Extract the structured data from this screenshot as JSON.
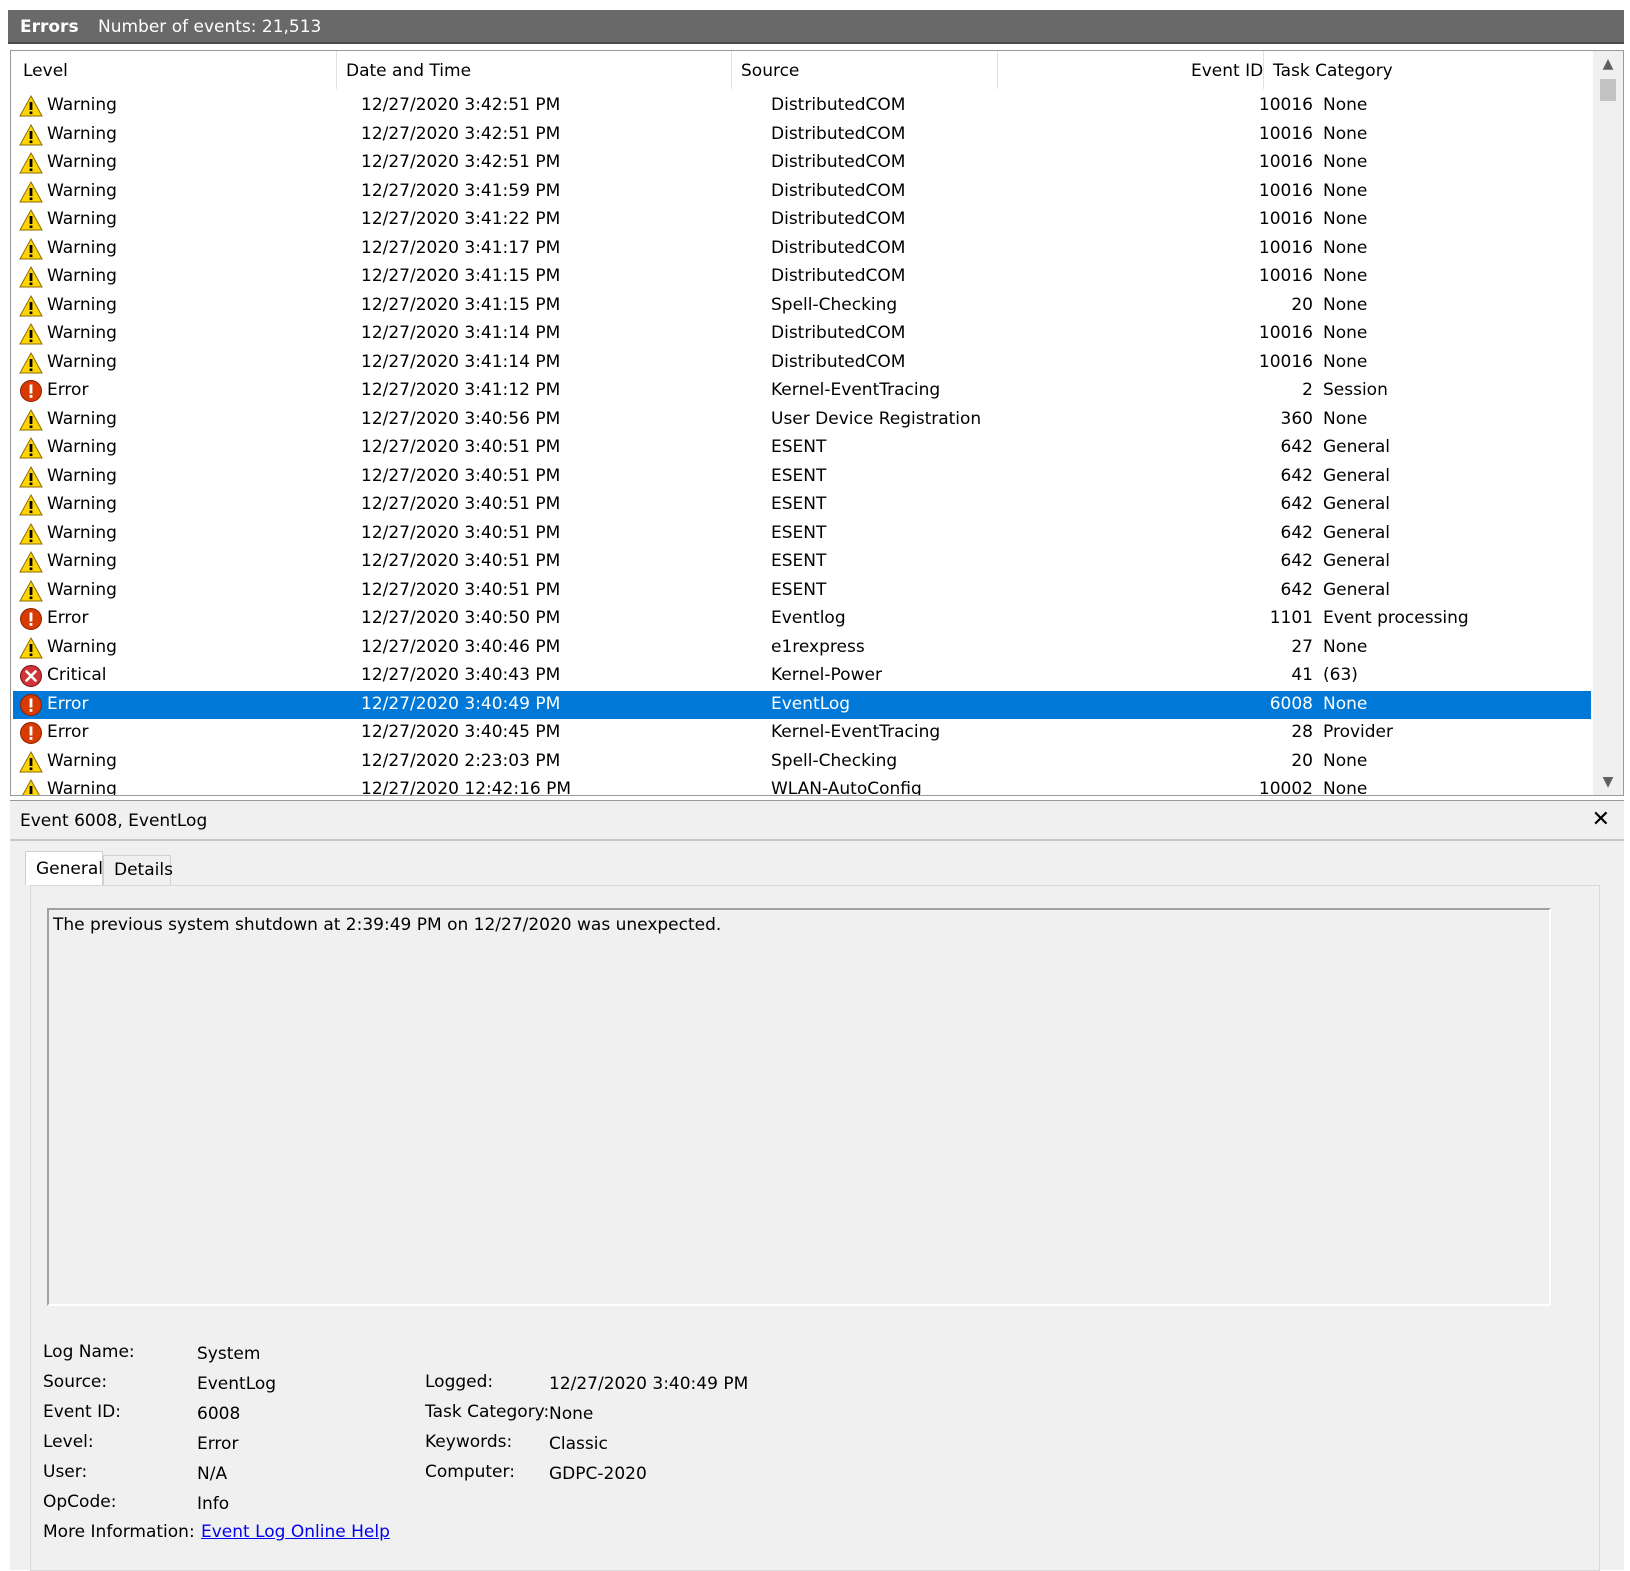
{
  "header": {
    "title": "Errors",
    "count_text": "Number of events: 21,513"
  },
  "columns": {
    "level": "Level",
    "date": "Date and Time",
    "source": "Source",
    "event_id": "Event ID",
    "task": "Task Category"
  },
  "colors": {
    "selected": "#0078d7",
    "warning": "#ffd400",
    "error": "#d83b01",
    "critical": "#d13438"
  },
  "events": [
    {
      "level": "Warning",
      "icon": "warning-icon",
      "date": "12/27/2020 3:42:51 PM",
      "source": "DistributedCOM",
      "id": "10016",
      "task": "None"
    },
    {
      "level": "Warning",
      "icon": "warning-icon",
      "date": "12/27/2020 3:42:51 PM",
      "source": "DistributedCOM",
      "id": "10016",
      "task": "None"
    },
    {
      "level": "Warning",
      "icon": "warning-icon",
      "date": "12/27/2020 3:42:51 PM",
      "source": "DistributedCOM",
      "id": "10016",
      "task": "None"
    },
    {
      "level": "Warning",
      "icon": "warning-icon",
      "date": "12/27/2020 3:41:59 PM",
      "source": "DistributedCOM",
      "id": "10016",
      "task": "None"
    },
    {
      "level": "Warning",
      "icon": "warning-icon",
      "date": "12/27/2020 3:41:22 PM",
      "source": "DistributedCOM",
      "id": "10016",
      "task": "None"
    },
    {
      "level": "Warning",
      "icon": "warning-icon",
      "date": "12/27/2020 3:41:17 PM",
      "source": "DistributedCOM",
      "id": "10016",
      "task": "None"
    },
    {
      "level": "Warning",
      "icon": "warning-icon",
      "date": "12/27/2020 3:41:15 PM",
      "source": "DistributedCOM",
      "id": "10016",
      "task": "None"
    },
    {
      "level": "Warning",
      "icon": "warning-icon",
      "date": "12/27/2020 3:41:15 PM",
      "source": "Spell-Checking",
      "id": "20",
      "task": "None"
    },
    {
      "level": "Warning",
      "icon": "warning-icon",
      "date": "12/27/2020 3:41:14 PM",
      "source": "DistributedCOM",
      "id": "10016",
      "task": "None"
    },
    {
      "level": "Warning",
      "icon": "warning-icon",
      "date": "12/27/2020 3:41:14 PM",
      "source": "DistributedCOM",
      "id": "10016",
      "task": "None"
    },
    {
      "level": "Error",
      "icon": "error-icon",
      "date": "12/27/2020 3:41:12 PM",
      "source": "Kernel-EventTracing",
      "id": "2",
      "task": "Session"
    },
    {
      "level": "Warning",
      "icon": "warning-icon",
      "date": "12/27/2020 3:40:56 PM",
      "source": "User Device Registration",
      "id": "360",
      "task": "None"
    },
    {
      "level": "Warning",
      "icon": "warning-icon",
      "date": "12/27/2020 3:40:51 PM",
      "source": "ESENT",
      "id": "642",
      "task": "General"
    },
    {
      "level": "Warning",
      "icon": "warning-icon",
      "date": "12/27/2020 3:40:51 PM",
      "source": "ESENT",
      "id": "642",
      "task": "General"
    },
    {
      "level": "Warning",
      "icon": "warning-icon",
      "date": "12/27/2020 3:40:51 PM",
      "source": "ESENT",
      "id": "642",
      "task": "General"
    },
    {
      "level": "Warning",
      "icon": "warning-icon",
      "date": "12/27/2020 3:40:51 PM",
      "source": "ESENT",
      "id": "642",
      "task": "General"
    },
    {
      "level": "Warning",
      "icon": "warning-icon",
      "date": "12/27/2020 3:40:51 PM",
      "source": "ESENT",
      "id": "642",
      "task": "General"
    },
    {
      "level": "Warning",
      "icon": "warning-icon",
      "date": "12/27/2020 3:40:51 PM",
      "source": "ESENT",
      "id": "642",
      "task": "General"
    },
    {
      "level": "Error",
      "icon": "error-icon",
      "date": "12/27/2020 3:40:50 PM",
      "source": "Eventlog",
      "id": "1101",
      "task": "Event processing"
    },
    {
      "level": "Warning",
      "icon": "warning-icon",
      "date": "12/27/2020 3:40:46 PM",
      "source": "e1rexpress",
      "id": "27",
      "task": "None"
    },
    {
      "level": "Critical",
      "icon": "critical-icon",
      "date": "12/27/2020 3:40:43 PM",
      "source": "Kernel-Power",
      "id": "41",
      "task": "(63)"
    },
    {
      "level": "Error",
      "icon": "error-icon",
      "date": "12/27/2020 3:40:49 PM",
      "source": "EventLog",
      "id": "6008",
      "task": "None",
      "selected": true
    },
    {
      "level": "Error",
      "icon": "error-icon",
      "date": "12/27/2020 3:40:45 PM",
      "source": "Kernel-EventTracing",
      "id": "28",
      "task": "Provider"
    },
    {
      "level": "Warning",
      "icon": "warning-icon",
      "date": "12/27/2020 2:23:03 PM",
      "source": "Spell-Checking",
      "id": "20",
      "task": "None"
    },
    {
      "level": "Warning",
      "icon": "warning-icon",
      "date": "12/27/2020 12:42:16 PM",
      "source": "WLAN-AutoConfig",
      "id": "10002",
      "task": "None"
    }
  ],
  "detail": {
    "title": "Event 6008, EventLog",
    "tabs": [
      "General",
      "Details"
    ],
    "message": "The previous system shutdown at 2:39:49 PM on 12/27/2020 was unexpected.",
    "props": {
      "log_name_label": "Log Name:",
      "log_name": "System",
      "source_label": "Source:",
      "source": "EventLog",
      "event_id_label": "Event ID:",
      "event_id": "6008",
      "level_label": "Level:",
      "level": "Error",
      "user_label": "User:",
      "user": "N/A",
      "opcode_label": "OpCode:",
      "opcode": "Info",
      "more_info_label": "More Information:",
      "more_info_link": "Event Log Online Help",
      "logged_label": "Logged:",
      "logged": "12/27/2020 3:40:49 PM",
      "task_label": "Task Category:",
      "task": "None",
      "keywords_label": "Keywords:",
      "keywords": "Classic",
      "computer_label": "Computer:",
      "computer": "GDPC-2020"
    }
  }
}
